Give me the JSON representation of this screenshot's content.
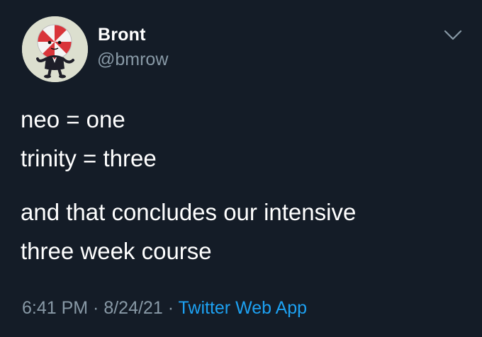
{
  "author": {
    "display_name": "Bront",
    "handle": "@bmrow"
  },
  "tweet": {
    "lines": [
      "neo = one",
      "trinity = three",
      "and that concludes our intensive",
      "three week course"
    ],
    "time": "6:41 PM",
    "separator": " · ",
    "date": "8/24/21",
    "source": "Twitter Web App"
  },
  "icons": {
    "avatar": "peppermint-butler-avatar",
    "menu": "chevron-down-icon"
  },
  "colors": {
    "background": "#141c27",
    "primary_text": "#ffffff",
    "secondary_text": "#8899a6",
    "link": "#1da1f2"
  }
}
